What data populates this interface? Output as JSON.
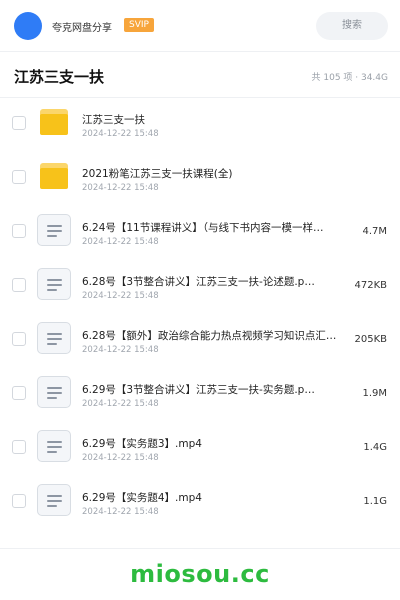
{
  "header": {
    "share_name": "夸克网盘分享",
    "vip_badge": "SVIP",
    "search_label": "搜索"
  },
  "folder": {
    "title": "江苏三支一扶",
    "meta": "共 105 项 · 34.4G"
  },
  "files": [
    {
      "type": "folder",
      "name": "江苏三支一扶",
      "date": "2024-12-22 15:48",
      "size": ""
    },
    {
      "type": "folder",
      "name": "2021粉笔江苏三支一扶课程(全)",
      "date": "2024-12-22 15:48",
      "size": ""
    },
    {
      "type": "doc",
      "name": "6.24号【11节课程讲义】（与线下书内容一模一样…",
      "date": "2024-12-22 15:48",
      "size": "4.7M"
    },
    {
      "type": "doc",
      "name": "6.28号【3节整合讲义】江苏三支一扶-论述题.p…",
      "date": "2024-12-22 15:48",
      "size": "472KB"
    },
    {
      "type": "doc",
      "name": "6.28号【额外】政治综合能力热点视频学习知识点汇…",
      "date": "2024-12-22 15:48",
      "size": "205KB"
    },
    {
      "type": "doc",
      "name": "6.29号【3节整合讲义】江苏三支一扶-实务题.p…",
      "date": "2024-12-22 15:48",
      "size": "1.9M"
    },
    {
      "type": "doc",
      "name": "6.29号【实务题3】.mp4",
      "date": "2024-12-22 15:48",
      "size": "1.4G"
    },
    {
      "type": "doc",
      "name": "6.29号【实务题4】.mp4",
      "date": "2024-12-22 15:48",
      "size": "1.1G"
    }
  ],
  "watermark": "miosou.cc",
  "colors": {
    "avatar": "#2f7cf6",
    "vip": "#f7a53b",
    "folder": "#f7c21a",
    "watermark": "#2dbb3f"
  }
}
